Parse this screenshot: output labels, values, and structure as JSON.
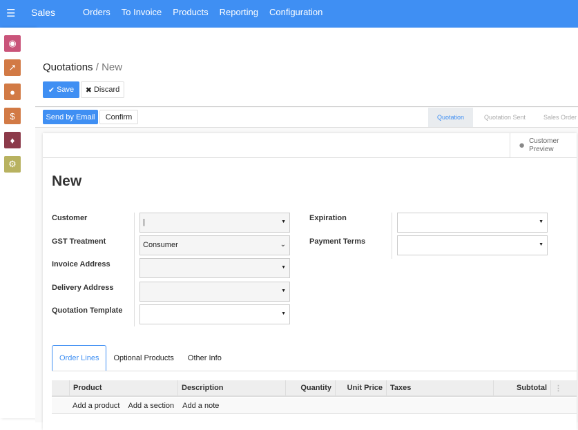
{
  "topbar": {
    "brand": "Sales",
    "menu": [
      "Orders",
      "To Invoice",
      "Products",
      "Reporting",
      "Configuration"
    ]
  },
  "sidebar": {
    "apps": [
      {
        "icon": "discuss-icon",
        "color": "#c9547a"
      },
      {
        "icon": "chart-icon",
        "color": "#d27a45"
      },
      {
        "icon": "globe-icon",
        "color": "#d27a45"
      },
      {
        "icon": "invoice-icon",
        "color": "#d27a45"
      },
      {
        "icon": "cubes-icon",
        "color": "#8c3b4a"
      },
      {
        "icon": "gear-icon",
        "color": "#b8b260"
      }
    ]
  },
  "breadcrumb": {
    "parent": "Quotations",
    "sep": "/",
    "current": "New"
  },
  "buttons": {
    "save": "Save",
    "discard": "Discard",
    "send_email": "Send by Email",
    "confirm": "Confirm"
  },
  "status": {
    "stages": [
      "Quotation",
      "Quotation Sent",
      "Sales Order"
    ],
    "active": "Quotation"
  },
  "sheet": {
    "preview_line1": "Customer",
    "preview_line2": "Preview",
    "title": "New",
    "left_fields": [
      {
        "label": "Customer",
        "value": ""
      },
      {
        "label": "GST Treatment",
        "value": "Consumer"
      },
      {
        "label": "Invoice Address",
        "value": ""
      },
      {
        "label": "Delivery Address",
        "value": ""
      },
      {
        "label": "Quotation Template",
        "value": ""
      }
    ],
    "right_fields": [
      {
        "label": "Expiration",
        "value": ""
      },
      {
        "label": "Payment Terms",
        "value": ""
      }
    ]
  },
  "tabs": [
    "Order Lines",
    "Optional Products",
    "Other Info"
  ],
  "table": {
    "columns": [
      "Product",
      "Description",
      "Quantity",
      "Unit Price",
      "Taxes",
      "Subtotal"
    ],
    "actions": [
      "Add a product",
      "Add a section",
      "Add a note"
    ]
  }
}
